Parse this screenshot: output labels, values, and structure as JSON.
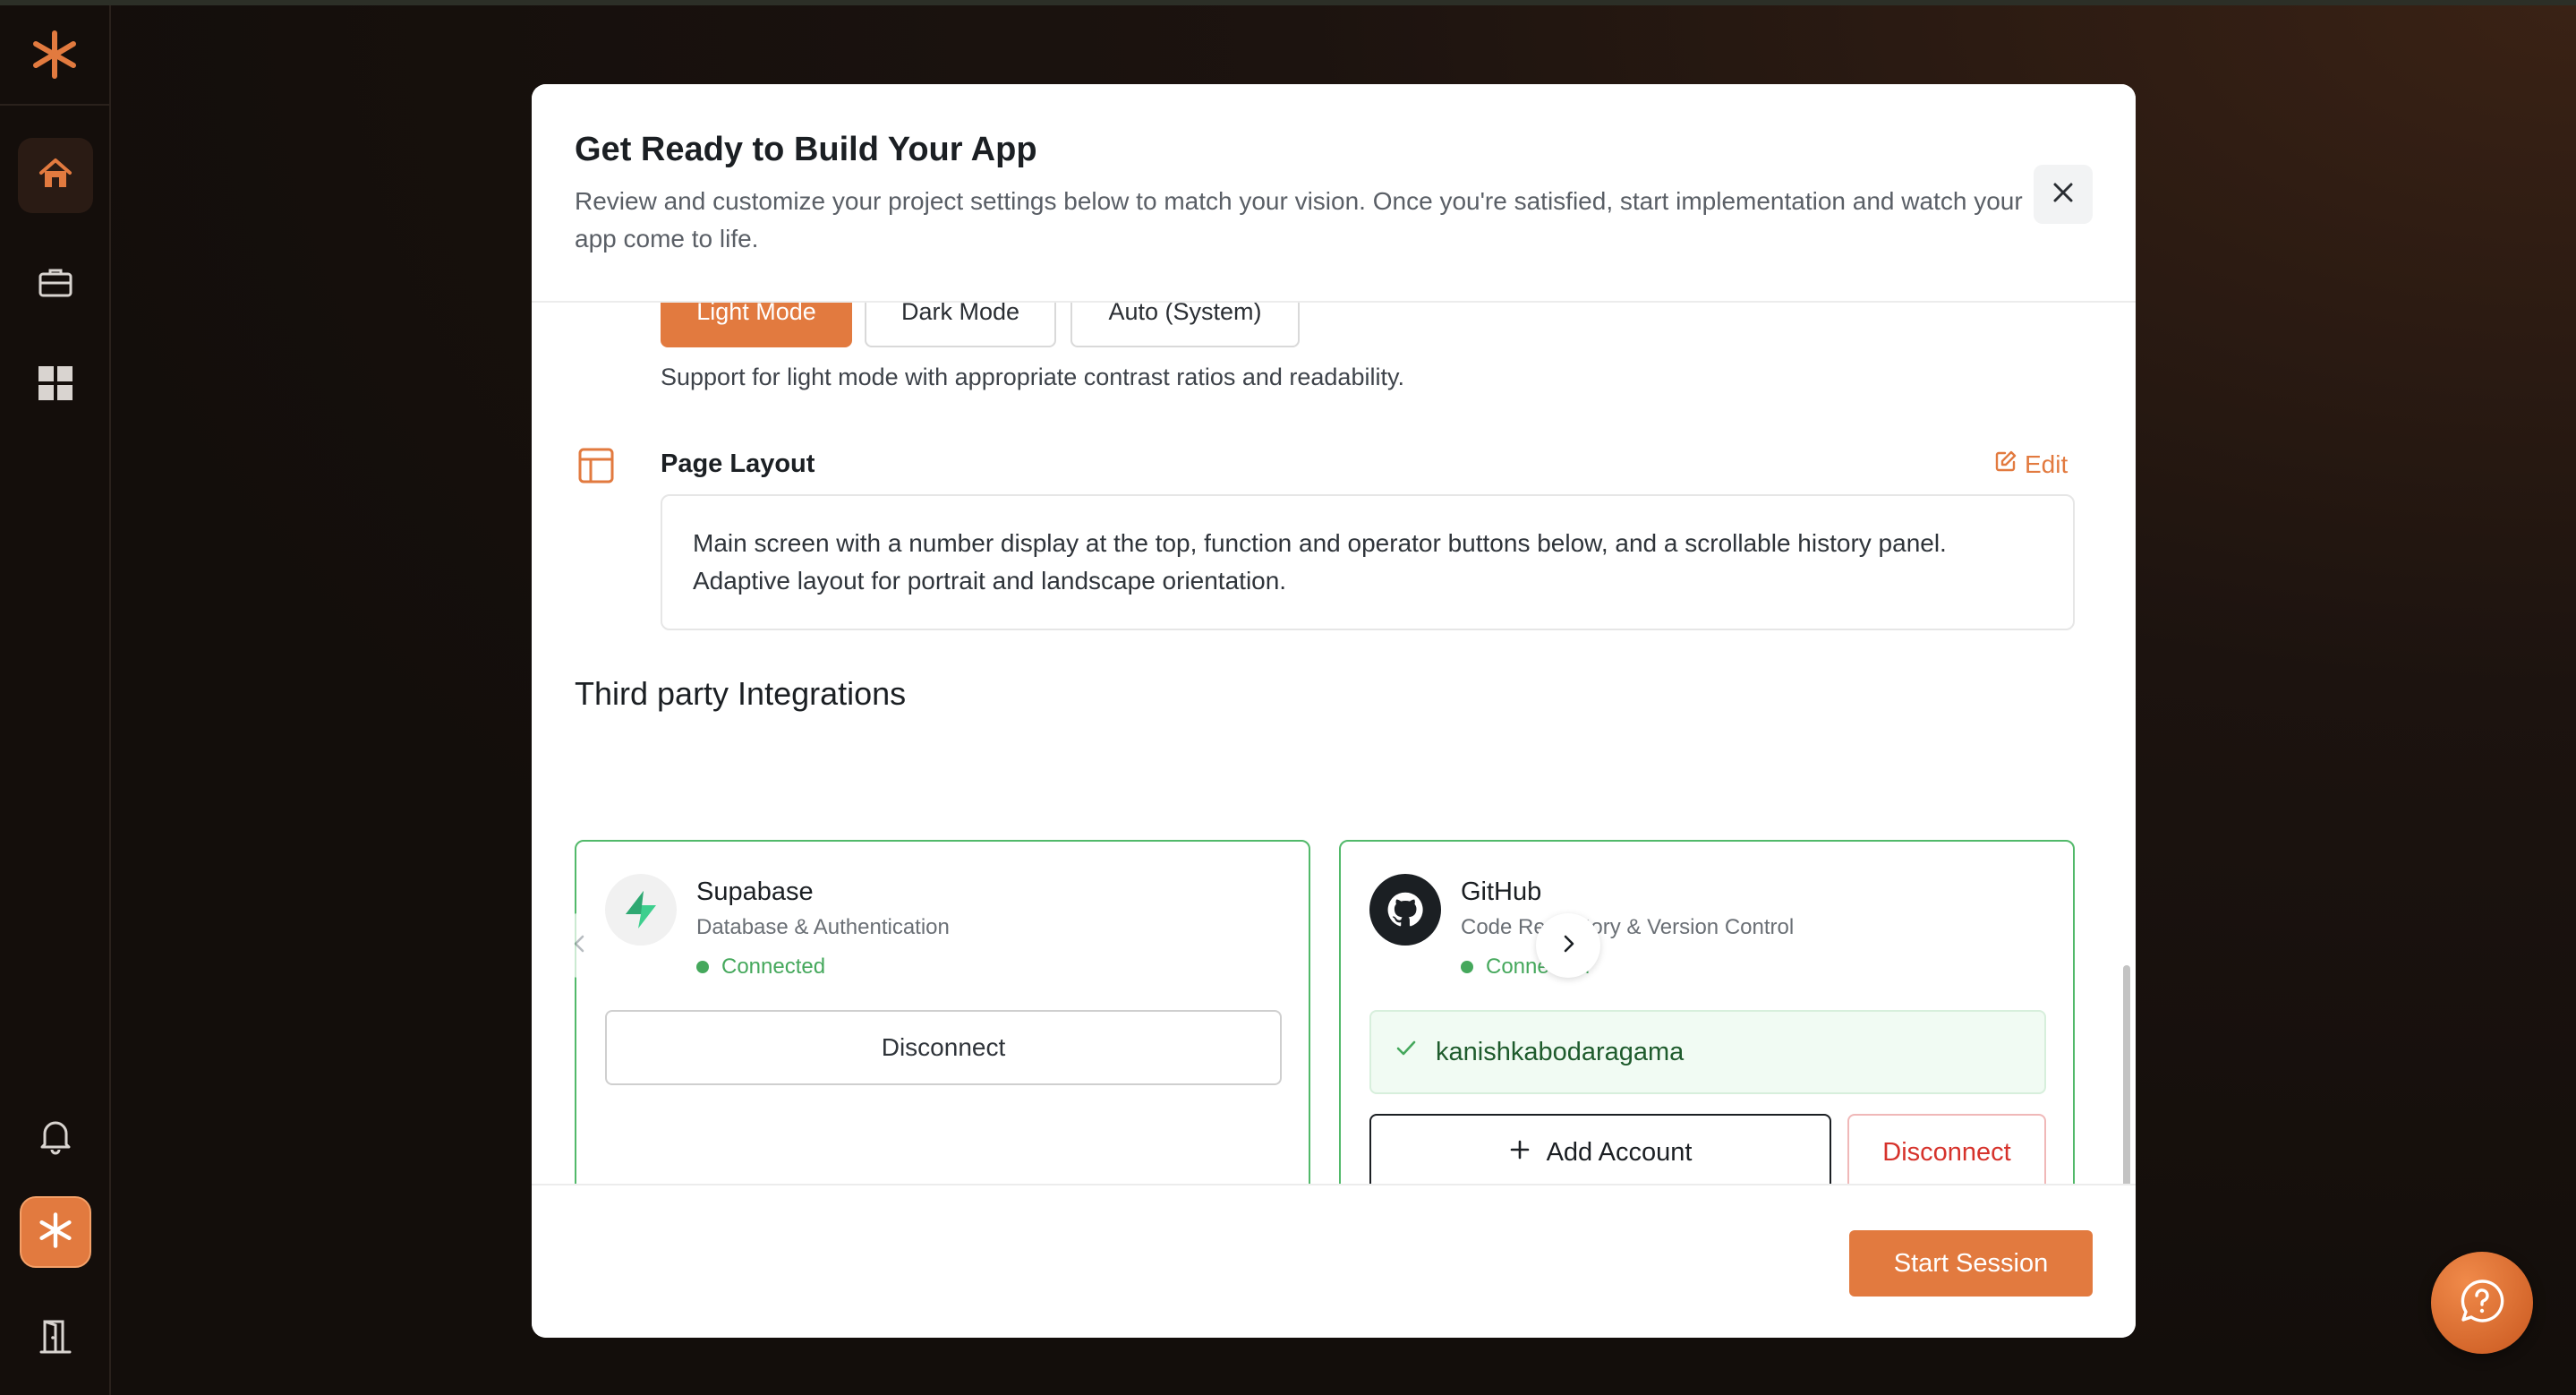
{
  "sidebar": {
    "items": [
      {
        "icon": "home-icon",
        "active": true
      },
      {
        "icon": "briefcase-icon"
      },
      {
        "icon": "grid-icon"
      },
      {
        "icon": "bell-icon"
      },
      {
        "icon": "brand-asterisk-icon"
      },
      {
        "icon": "logout-door-icon"
      }
    ]
  },
  "modal": {
    "title": "Get Ready to Build Your App",
    "subtitle": "Review and customize your project settings below to match your vision. Once you're satisfied, start implementation and watch your app come to life.",
    "theme": {
      "options": [
        "Light Mode",
        "Dark Mode",
        "Auto (System)"
      ],
      "selected": "Light Mode",
      "description": "Support for light mode with appropriate contrast ratios and readability."
    },
    "page_layout": {
      "label": "Page Layout",
      "edit_label": "Edit",
      "text": "Main screen with a number display at the top, function and operator buttons below, and a scrollable history panel. Adaptive layout for portrait and landscape orientation."
    },
    "integrations": {
      "title": "Third party Integrations",
      "cards": [
        {
          "name": "Supabase",
          "description": "Database & Authentication",
          "status": "Connected",
          "disconnect_label": "Disconnect"
        },
        {
          "name": "GitHub",
          "description": "Code Repository & Version Control",
          "status": "Connected",
          "account": "kanishkabodaragama",
          "add_account_label": "Add Account",
          "disconnect_label": "Disconnect"
        }
      ],
      "pager": {
        "current": 1,
        "total": 2
      }
    },
    "footer": {
      "start_label": "Start Session"
    }
  },
  "colors": {
    "accent": "#e27a3f",
    "connected": "#45a85c",
    "danger": "#d6322b"
  }
}
